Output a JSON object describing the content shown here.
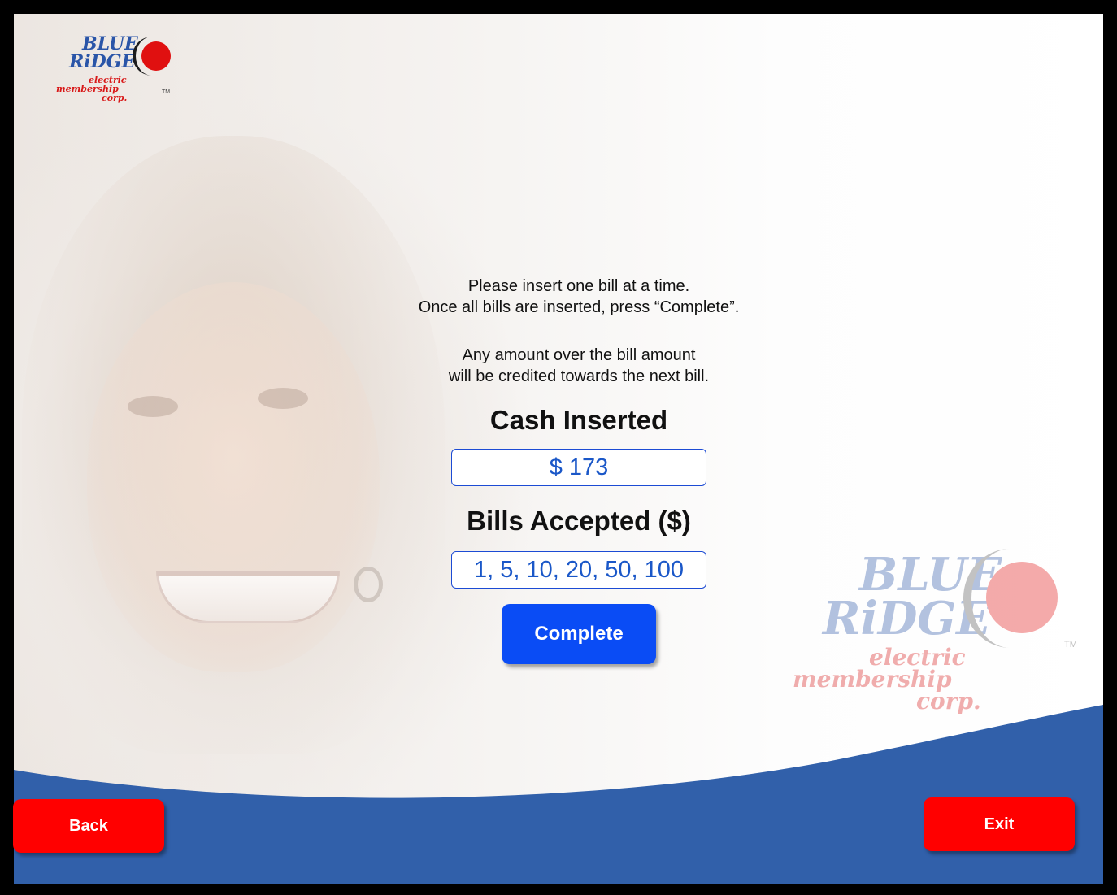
{
  "brand": {
    "line1": "BLUE",
    "line2": "RiDGE",
    "line3": "electric",
    "line4": "membership",
    "line5": "corp.",
    "tm": "TM",
    "colors": {
      "blue": "#2a55a8",
      "red": "#d81818"
    }
  },
  "instructions": {
    "line1": "Please insert one bill at a time.",
    "line2": "Once all bills are inserted, press “Complete”.",
    "line3": "Any amount over the bill amount",
    "line4": "will be credited towards the next bill."
  },
  "cash": {
    "title": "Cash Inserted",
    "value": "$ 173"
  },
  "bills": {
    "title": "Bills Accepted ($)",
    "value": "1, 5, 10, 20, 50, 100"
  },
  "buttons": {
    "complete": "Complete",
    "back": "Back",
    "exit": "Exit"
  },
  "colors": {
    "primary_button": "#0a4cf5",
    "nav_button": "#ff0000",
    "footer_wave": "#3160aa",
    "value_text": "#1a57c8"
  }
}
